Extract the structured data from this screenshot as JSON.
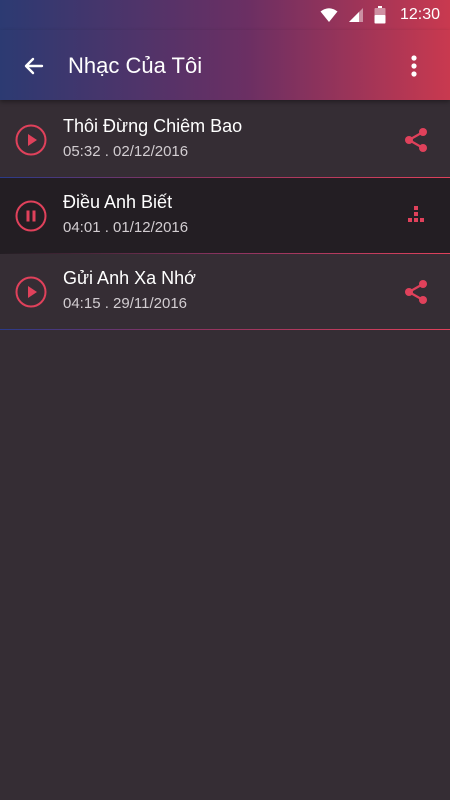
{
  "status_bar": {
    "time": "12:30",
    "icons": [
      "wifi-icon",
      "cellular-signal-icon",
      "battery-icon"
    ]
  },
  "app_bar": {
    "title": "Nhạc Của Tôi",
    "back_icon": "arrow-back-icon",
    "menu_icon": "more-vert-icon"
  },
  "colors": {
    "accent": "#e0415b",
    "gradient_start": "#2c3a72",
    "gradient_end": "#c9394f",
    "background": "#352d34",
    "active_row": "#231e23"
  },
  "songs": [
    {
      "title": "Thôi Đừng Chiêm Bao",
      "meta": "05:32 . 02/12/2016",
      "state": "stopped",
      "state_icon": "play-icon",
      "action_icon": "share-icon"
    },
    {
      "title": "Điều Anh Biết",
      "meta": "04:01 . 01/12/2016",
      "state": "playing",
      "state_icon": "pause-icon",
      "action_icon": "equalizer-icon"
    },
    {
      "title": "Gửi Anh Xa Nhớ",
      "meta": "04:15 . 29/11/2016",
      "state": "stopped",
      "state_icon": "play-icon",
      "action_icon": "share-icon"
    }
  ]
}
